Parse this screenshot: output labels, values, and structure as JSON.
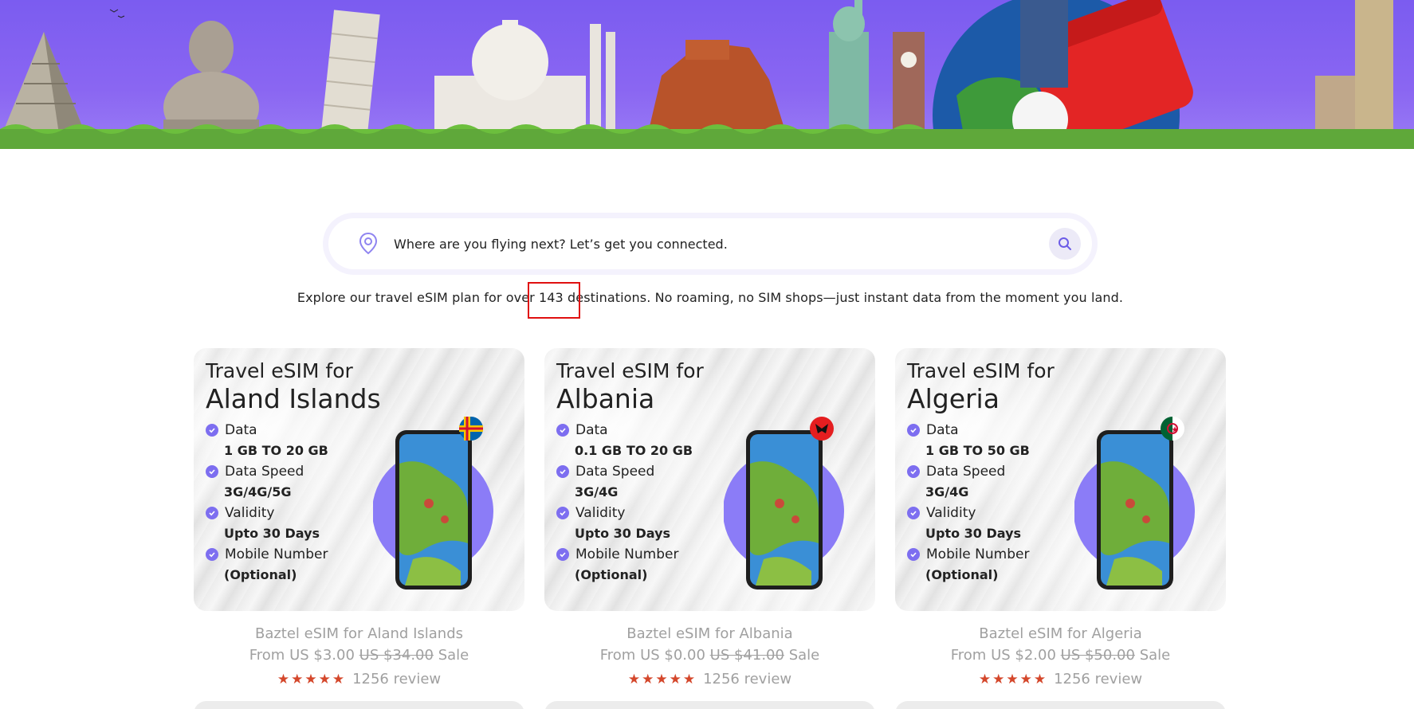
{
  "search": {
    "placeholder": "Where are you flying next? Let’s get you connected."
  },
  "tagline": "Explore our travel eSIM plan for over 143 destinations. No roaming, no SIM shops—just instant data from the moment you land.",
  "icons": {
    "location": "location-pin-icon",
    "search": "search-icon",
    "check": "check-circle-icon",
    "star": "star-icon"
  },
  "colors": {
    "accent": "#7d6ef0",
    "star": "#d4472b",
    "meta_text": "#a0a0a0"
  },
  "cards": [
    {
      "title_prefix": "Travel eSIM for",
      "country": "Aland Islands",
      "flag": "aland-flag-icon",
      "features": [
        {
          "label": "Data",
          "value": "1 GB TO 20 GB"
        },
        {
          "label": "Data Speed",
          "value": "3G/4G/5G"
        },
        {
          "label": "Validity",
          "value": "Upto 30 Days"
        },
        {
          "label": "Mobile Number",
          "value": "(Optional)"
        }
      ],
      "product_name": "Baztel eSIM for Aland Islands",
      "price_from": "From US $3.00",
      "price_old": "US $34.00",
      "sale_label": "Sale",
      "stars": "★★★★★",
      "rating": 5,
      "reviews": "1256 review"
    },
    {
      "title_prefix": "Travel eSIM for",
      "country": "Albania",
      "flag": "albania-flag-icon",
      "features": [
        {
          "label": "Data",
          "value": "0.1 GB TO 20 GB"
        },
        {
          "label": "Data Speed",
          "value": "3G/4G"
        },
        {
          "label": "Validity",
          "value": "Upto 30 Days"
        },
        {
          "label": "Mobile Number",
          "value": "(Optional)"
        }
      ],
      "product_name": "Baztel eSIM for Albania",
      "price_from": "From US $0.00",
      "price_old": "US $41.00",
      "sale_label": "Sale",
      "stars": "★★★★★",
      "rating": 5,
      "reviews": "1256 review"
    },
    {
      "title_prefix": "Travel eSIM for",
      "country": "Algeria",
      "flag": "algeria-flag-icon",
      "features": [
        {
          "label": "Data",
          "value": "1 GB TO 50 GB"
        },
        {
          "label": "Data Speed",
          "value": "3G/4G"
        },
        {
          "label": "Validity",
          "value": "Upto 30 Days"
        },
        {
          "label": "Mobile Number",
          "value": "(Optional)"
        }
      ],
      "product_name": "Baztel eSIM for Algeria",
      "price_from": "From US $2.00",
      "price_old": "US $50.00",
      "sale_label": "Sale",
      "stars": "★★★★★",
      "rating": 5,
      "reviews": "1256 review"
    }
  ]
}
